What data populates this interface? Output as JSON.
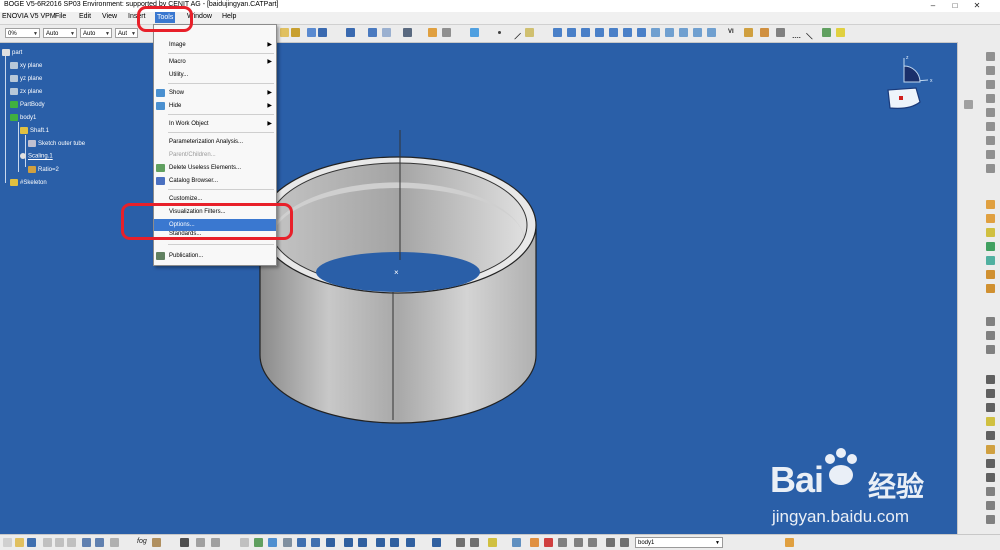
{
  "window": {
    "title": "BOGE V5-6R2016 SP03 Environment: supported by CENIT AG - [baidujingyan.CATPart]",
    "minimize_glyph": "–",
    "maximize_glyph": "□",
    "close_glyph": "✕"
  },
  "menubar": {
    "items": [
      "ENOVIA V5 VPM",
      "File",
      "Edit",
      "View",
      "Insert",
      "Tools",
      "Window",
      "Help"
    ],
    "active": "Tools"
  },
  "toolbar": {
    "combo1": "0%",
    "combo2": "Auto",
    "combo3": "Auto",
    "combo4": "Aut",
    "label_vi": "VI"
  },
  "tree": {
    "root": "part",
    "nodes": [
      "xy plane",
      "yz plane",
      "zx plane",
      "PartBody",
      "body1",
      "Shaft.1",
      "Sketch outer tube",
      "Scaling.1",
      "Ratio=2",
      "#Skeleton"
    ]
  },
  "tools_menu": {
    "items": [
      {
        "label": "Image",
        "submenu": true
      },
      {
        "label": "Macro",
        "submenu": true
      },
      {
        "label": "Utility...",
        "submenu": false
      },
      {
        "label": "Show",
        "submenu": true
      },
      {
        "label": "Hide",
        "submenu": true
      },
      {
        "label": "In Work Object",
        "submenu": true
      },
      {
        "label": "Parameterization Analysis...",
        "submenu": false
      },
      {
        "label": "Parent/Children...",
        "submenu": false,
        "disabled": true
      },
      {
        "label": "Delete Useless Elements...",
        "submenu": false
      },
      {
        "label": "Catalog Browser...",
        "submenu": false
      },
      {
        "label": "Customize...",
        "submenu": false
      },
      {
        "label": "Visualization Filters...",
        "submenu": false
      },
      {
        "label": "Options...",
        "submenu": false,
        "highlighted": true
      },
      {
        "label": "Standards...",
        "submenu": false
      },
      {
        "label": "Publication...",
        "submenu": false
      }
    ]
  },
  "bottombar": {
    "body_combo": "body1",
    "label_fog": "fog"
  },
  "compass": {
    "x_label": "x",
    "z_label": "z"
  },
  "watermark": {
    "brand": "Bai",
    "brand_cn": "经验",
    "url": "jingyan.baidu.com"
  },
  "colors": {
    "viewport_bg": "#2a5fa8",
    "highlight": "#3a78d0",
    "annotation_red": "#e8202a"
  }
}
